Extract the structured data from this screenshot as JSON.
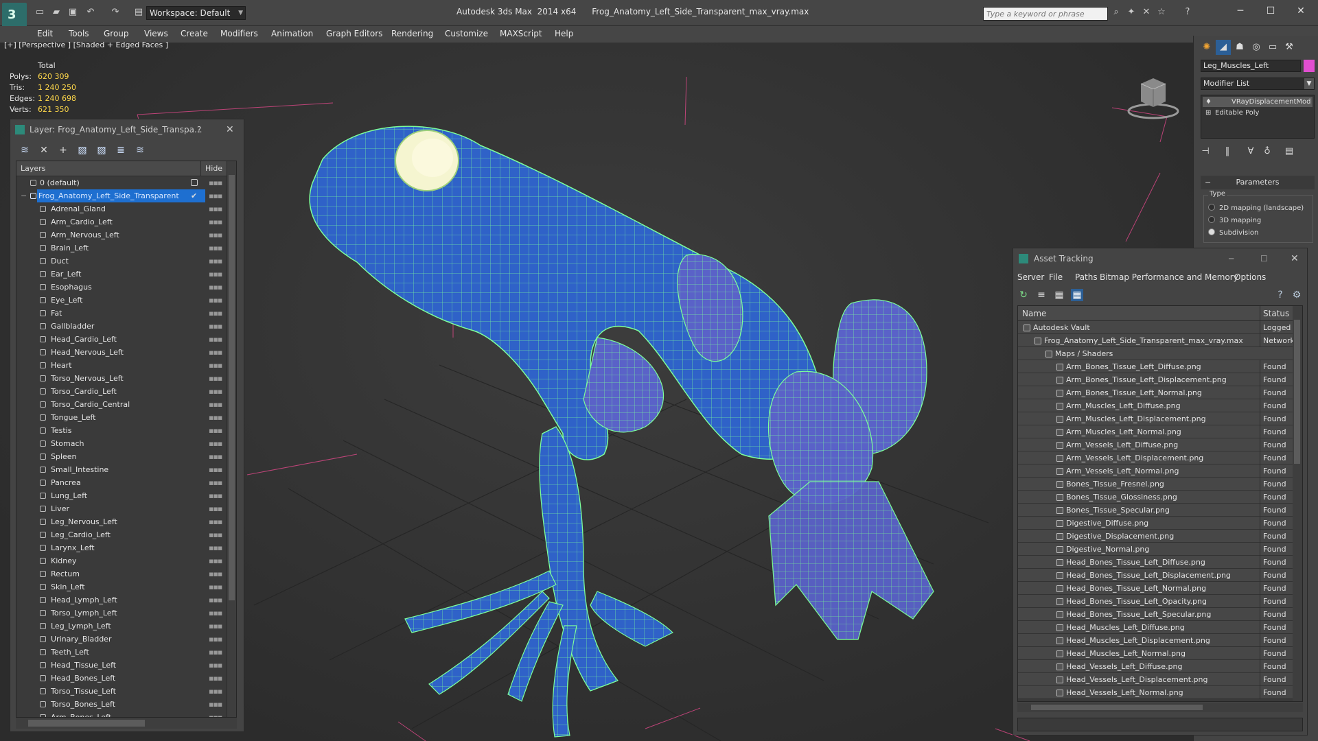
{
  "window": {
    "app": "Autodesk 3ds Max  2014 x64",
    "file": "Frog_Anatomy_Left_Side_Transparent_max_vray.max",
    "workspace": "Workspace: Default",
    "search_placeholder": "Type a keyword or phrase"
  },
  "menu": [
    "Edit",
    "Tools",
    "Group",
    "Views",
    "Create",
    "Modifiers",
    "Animation",
    "Graph Editors",
    "Rendering",
    "Customize",
    "MAXScript",
    "Help"
  ],
  "viewport": {
    "label": "[+] [Perspective ] [Shaded + Edged Faces ]",
    "stats_header": "Total",
    "stats": [
      {
        "label": "Polys:",
        "value": "620 309"
      },
      {
        "label": "Tris:",
        "value": "1 240 250"
      },
      {
        "label": "Edges:",
        "value": "1 240 698"
      },
      {
        "label": "Verts:",
        "value": "621 350"
      }
    ]
  },
  "layer_explorer": {
    "title": "Layer: Frog_Anatomy_Left_Side_Transpa...",
    "help": "?",
    "col_layers": "Layers",
    "col_hide": "Hide",
    "default_layer": "0 (default)",
    "active_layer": "Frog_Anatomy_Left_Side_Transparent",
    "layers": [
      "Adrenal_Gland",
      "Arm_Cardio_Left",
      "Arm_Nervous_Left",
      "Brain_Left",
      "Duct",
      "Ear_Left",
      "Esophagus",
      "Eye_Left",
      "Fat",
      "Gallbladder",
      "Head_Cardio_Left",
      "Head_Nervous_Left",
      "Heart",
      "Torso_Nervous_Left",
      "Torso_Cardio_Left",
      "Torso_Cardio_Central",
      "Tongue_Left",
      "Testis",
      "Stomach",
      "Spleen",
      "Small_Intestine",
      "Pancrea",
      "Lung_Left",
      "Liver",
      "Leg_Nervous_Left",
      "Leg_Cardio_Left",
      "Larynx_Left",
      "Kidney",
      "Rectum",
      "Skin_Left",
      "Head_Lymph_Left",
      "Torso_Lymph_Left",
      "Leg_Lymph_Left",
      "Urinary_Bladder",
      "Teeth_Left",
      "Head_Tissue_Left",
      "Head_Bones_Left",
      "Torso_Tissue_Left",
      "Torso_Bones_Left",
      "Arm_Bones_Left"
    ]
  },
  "command_panel": {
    "object_name": "Leg_Muscles_Left",
    "object_color": "#e14fd0",
    "modifier_list": "Modifier List",
    "stack": [
      "VRayDisplacementMod",
      "Editable Poly"
    ],
    "rollout": "Parameters",
    "group": "Type",
    "radios": [
      {
        "label": "2D mapping (landscape)",
        "checked": false
      },
      {
        "label": "3D mapping",
        "checked": false
      },
      {
        "label": "Subdivision",
        "checked": true
      }
    ]
  },
  "asset_tracking": {
    "title": "Asset Tracking",
    "menu": [
      "Server",
      "File",
      "Paths",
      "Bitmap Performance and Memory",
      "Options"
    ],
    "col_name": "Name",
    "col_status": "Status",
    "rows": [
      {
        "name": "Autodesk Vault",
        "status": "Logged O",
        "level": 1
      },
      {
        "name": "Frog_Anatomy_Left_Side_Transparent_max_vray.max",
        "status": "Network",
        "level": 2
      },
      {
        "name": "Maps / Shaders",
        "status": "",
        "level": 3
      },
      {
        "name": "Arm_Bones_Tissue_Left_Diffuse.png",
        "status": "Found",
        "level": 4
      },
      {
        "name": "Arm_Bones_Tissue_Left_Displacement.png",
        "status": "Found",
        "level": 4
      },
      {
        "name": "Arm_Bones_Tissue_Left_Normal.png",
        "status": "Found",
        "level": 4
      },
      {
        "name": "Arm_Muscles_Left_Diffuse.png",
        "status": "Found",
        "level": 4
      },
      {
        "name": "Arm_Muscles_Left_Displacement.png",
        "status": "Found",
        "level": 4
      },
      {
        "name": "Arm_Muscles_Left_Normal.png",
        "status": "Found",
        "level": 4
      },
      {
        "name": "Arm_Vessels_Left_Diffuse.png",
        "status": "Found",
        "level": 4
      },
      {
        "name": "Arm_Vessels_Left_Displacement.png",
        "status": "Found",
        "level": 4
      },
      {
        "name": "Arm_Vessels_Left_Normal.png",
        "status": "Found",
        "level": 4
      },
      {
        "name": "Bones_Tissue_Fresnel.png",
        "status": "Found",
        "level": 4
      },
      {
        "name": "Bones_Tissue_Glossiness.png",
        "status": "Found",
        "level": 4
      },
      {
        "name": "Bones_Tissue_Specular.png",
        "status": "Found",
        "level": 4
      },
      {
        "name": "Digestive_Diffuse.png",
        "status": "Found",
        "level": 4
      },
      {
        "name": "Digestive_Displacement.png",
        "status": "Found",
        "level": 4
      },
      {
        "name": "Digestive_Normal.png",
        "status": "Found",
        "level": 4
      },
      {
        "name": "Head_Bones_Tissue_Left_Diffuse.png",
        "status": "Found",
        "level": 4
      },
      {
        "name": "Head_Bones_Tissue_Left_Displacement.png",
        "status": "Found",
        "level": 4
      },
      {
        "name": "Head_Bones_Tissue_Left_Normal.png",
        "status": "Found",
        "level": 4
      },
      {
        "name": "Head_Bones_Tissue_Left_Opacity.png",
        "status": "Found",
        "level": 4
      },
      {
        "name": "Head_Bones_Tissue_Left_Specular.png",
        "status": "Found",
        "level": 4
      },
      {
        "name": "Head_Muscles_Left_Diffuse.png",
        "status": "Found",
        "level": 4
      },
      {
        "name": "Head_Muscles_Left_Displacement.png",
        "status": "Found",
        "level": 4
      },
      {
        "name": "Head_Muscles_Left_Normal.png",
        "status": "Found",
        "level": 4
      },
      {
        "name": "Head_Vessels_Left_Diffuse.png",
        "status": "Found",
        "level": 4
      },
      {
        "name": "Head_Vessels_Left_Displacement.png",
        "status": "Found",
        "level": 4
      },
      {
        "name": "Head_Vessels_Left_Normal.png",
        "status": "Found",
        "level": 4
      }
    ]
  },
  "colors": {
    "wire": "#7dff9a",
    "skin": "#2f6fd6",
    "selection": "#1e6fd0",
    "stat_value": "#ffd84a"
  }
}
